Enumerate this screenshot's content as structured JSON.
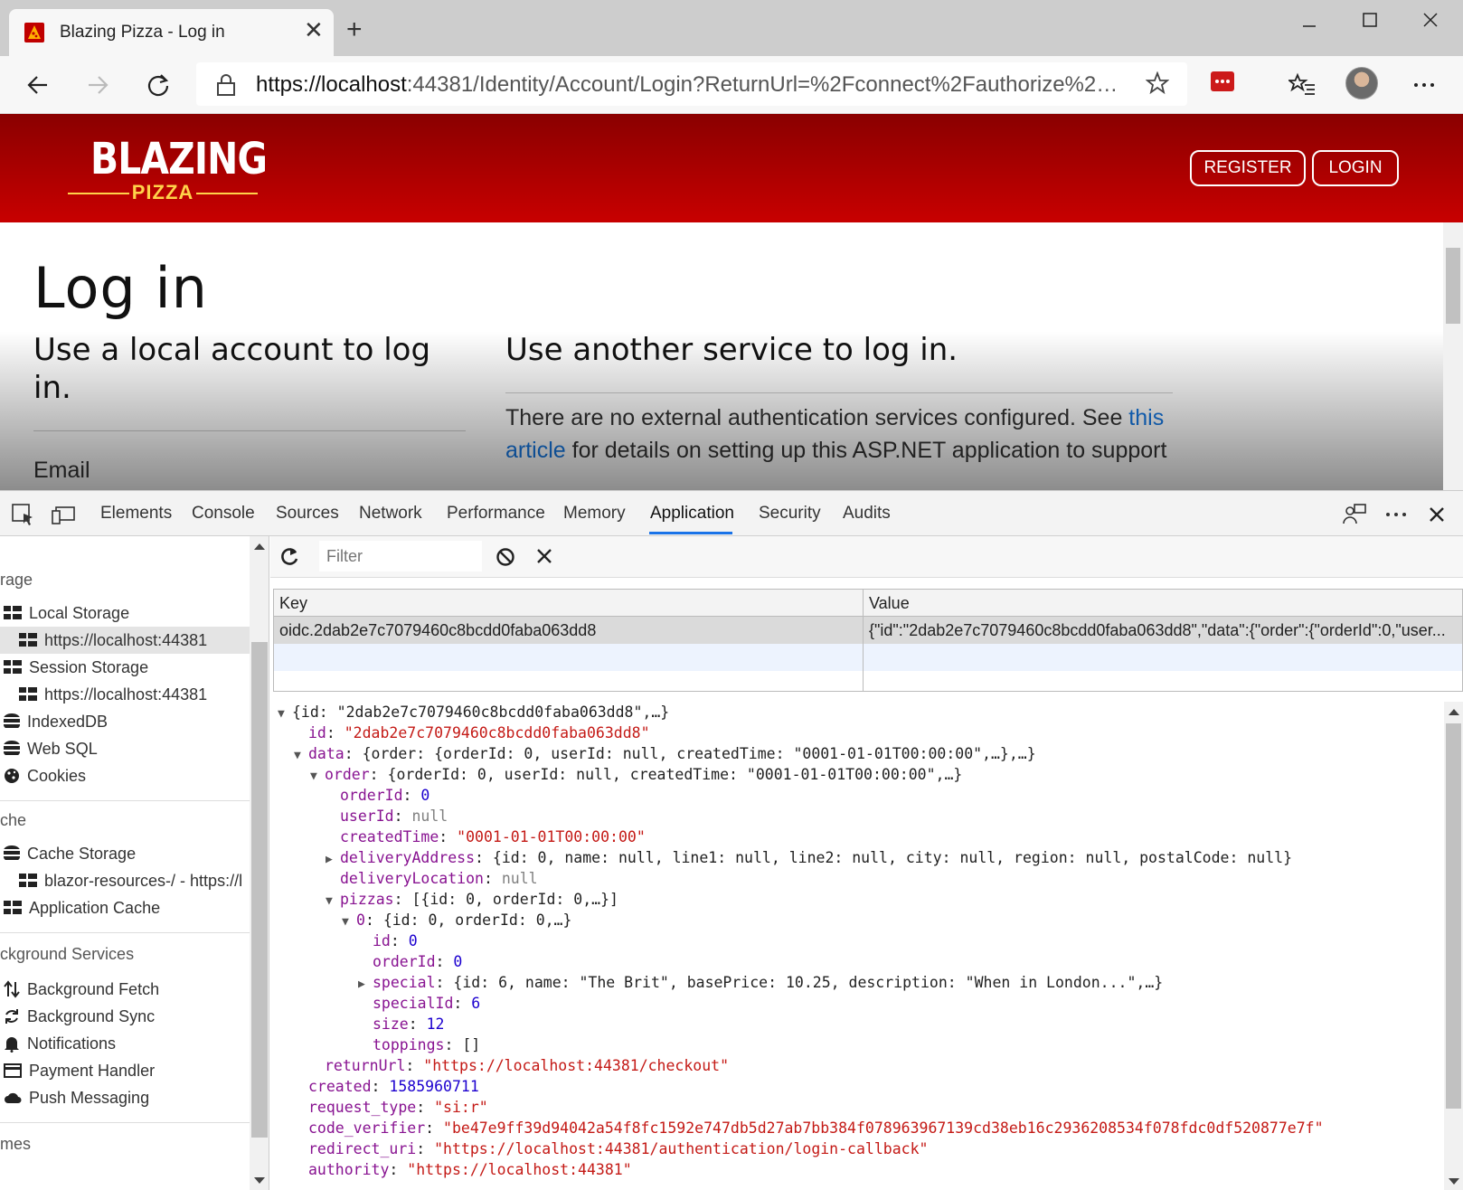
{
  "browser": {
    "tab_title": "Blazing Pizza - Log in",
    "url_host": "https://localhost",
    "url_rest": ":44381/Identity/Account/Login?ReturnUrl=%2Fconnect%2Fauthorize%2F..."
  },
  "site": {
    "logo_main": "BLAZING",
    "logo_sub": "PIZZA",
    "register_label": "REGISTER",
    "login_label": "LOGIN"
  },
  "page": {
    "title": "Log in",
    "local_heading": "Use a local account to log in.",
    "external_heading": "Use another service to log in.",
    "external_text_1": "There are no external authentication services configured. See ",
    "external_link": "this article",
    "external_text_2": " for details on setting up this ASP.NET application to support",
    "email_label": "Email"
  },
  "devtools": {
    "tabs": [
      "Elements",
      "Console",
      "Sources",
      "Network",
      "Performance",
      "Memory",
      "Application",
      "Security",
      "Audits"
    ],
    "active_tab": "Application",
    "filter_placeholder": "Filter",
    "sidebar": {
      "storage_section": "rage",
      "local_storage": "Local Storage",
      "local_storage_origin": "https://localhost:44381",
      "session_storage": "Session Storage",
      "session_storage_origin": "https://localhost:44381",
      "indexeddb": "IndexedDB",
      "websql": "Web SQL",
      "cookies": "Cookies",
      "cache_section": "che",
      "cache_storage": "Cache Storage",
      "cache_entry": "blazor-resources-/ - https://l",
      "app_cache": "Application Cache",
      "bg_section": "ckground Services",
      "bg_fetch": "Background Fetch",
      "bg_sync": "Background Sync",
      "notifications": "Notifications",
      "payment_handler": "Payment Handler",
      "push_messaging": "Push Messaging",
      "frames_section": "mes"
    },
    "table": {
      "key_header": "Key",
      "value_header": "Value",
      "row_key": "oidc.2dab2e7c7079460c8bcdd0faba063dd8",
      "row_value": "{\"id\":\"2dab2e7c7079460c8bcdd0faba063dd8\",\"data\":{\"order\":{\"orderId\":0,\"user..."
    },
    "json": {
      "root_summary": "{id: \"2dab2e7c7079460c8bcdd0faba063dd8\",…}",
      "id_key": "id",
      "id_val": "\"2dab2e7c7079460c8bcdd0faba063dd8\"",
      "data_key": "data",
      "data_summary": "{order: {orderId: 0, userId: null, createdTime: \"0001-01-01T00:00:00\",…},…}",
      "order_key": "order",
      "order_summary": "{orderId: 0, userId: null, createdTime: \"0001-01-01T00:00:00\",…}",
      "orderId_key": "orderId",
      "orderId_val": "0",
      "userId_key": "userId",
      "userId_val": "null",
      "createdTime_key": "createdTime",
      "createdTime_val": "\"0001-01-01T00:00:00\"",
      "deliveryAddress_key": "deliveryAddress",
      "deliveryAddress_summary": "{id: 0, name: null, line1: null, line2: null, city: null, region: null, postalCode: null}",
      "deliveryLocation_key": "deliveryLocation",
      "deliveryLocation_val": "null",
      "pizzas_key": "pizzas",
      "pizzas_summary": "[{id: 0, orderId: 0,…}]",
      "pizza0_key": "0",
      "pizza0_summary": "{id: 0, orderId: 0,…}",
      "p_id_key": "id",
      "p_id_val": "0",
      "p_orderId_key": "orderId",
      "p_orderId_val": "0",
      "special_key": "special",
      "special_summary": "{id: 6, name: \"The Brit\", basePrice: 10.25, description: \"When in London...\",…}",
      "specialId_key": "specialId",
      "specialId_val": "6",
      "size_key": "size",
      "size_val": "12",
      "toppings_key": "toppings",
      "toppings_val": "[]",
      "returnUrl_key": "returnUrl",
      "returnUrl_val": "\"https://localhost:44381/checkout\"",
      "created_key": "created",
      "created_val": "1585960711",
      "request_type_key": "request_type",
      "request_type_val": "\"si:r\"",
      "code_verifier_key": "code_verifier",
      "code_verifier_val": "\"be47e9ff39d94042a54f8fc1592e747db5d27ab7bb384f078963967139cd38eb16c2936208534f078fdc0df520877e7f\"",
      "redirect_uri_key": "redirect_uri",
      "redirect_uri_val": "\"https://localhost:44381/authentication/login-callback\"",
      "authority_key": "authority",
      "authority_val": "\"https://localhost:44381\""
    }
  },
  "colors": {
    "header_top": "#8a0000",
    "header_bottom": "#c80000",
    "logo_accent": "#ffd24a",
    "link": "#1677e0",
    "active_tab_underline": "#1a73e8"
  }
}
